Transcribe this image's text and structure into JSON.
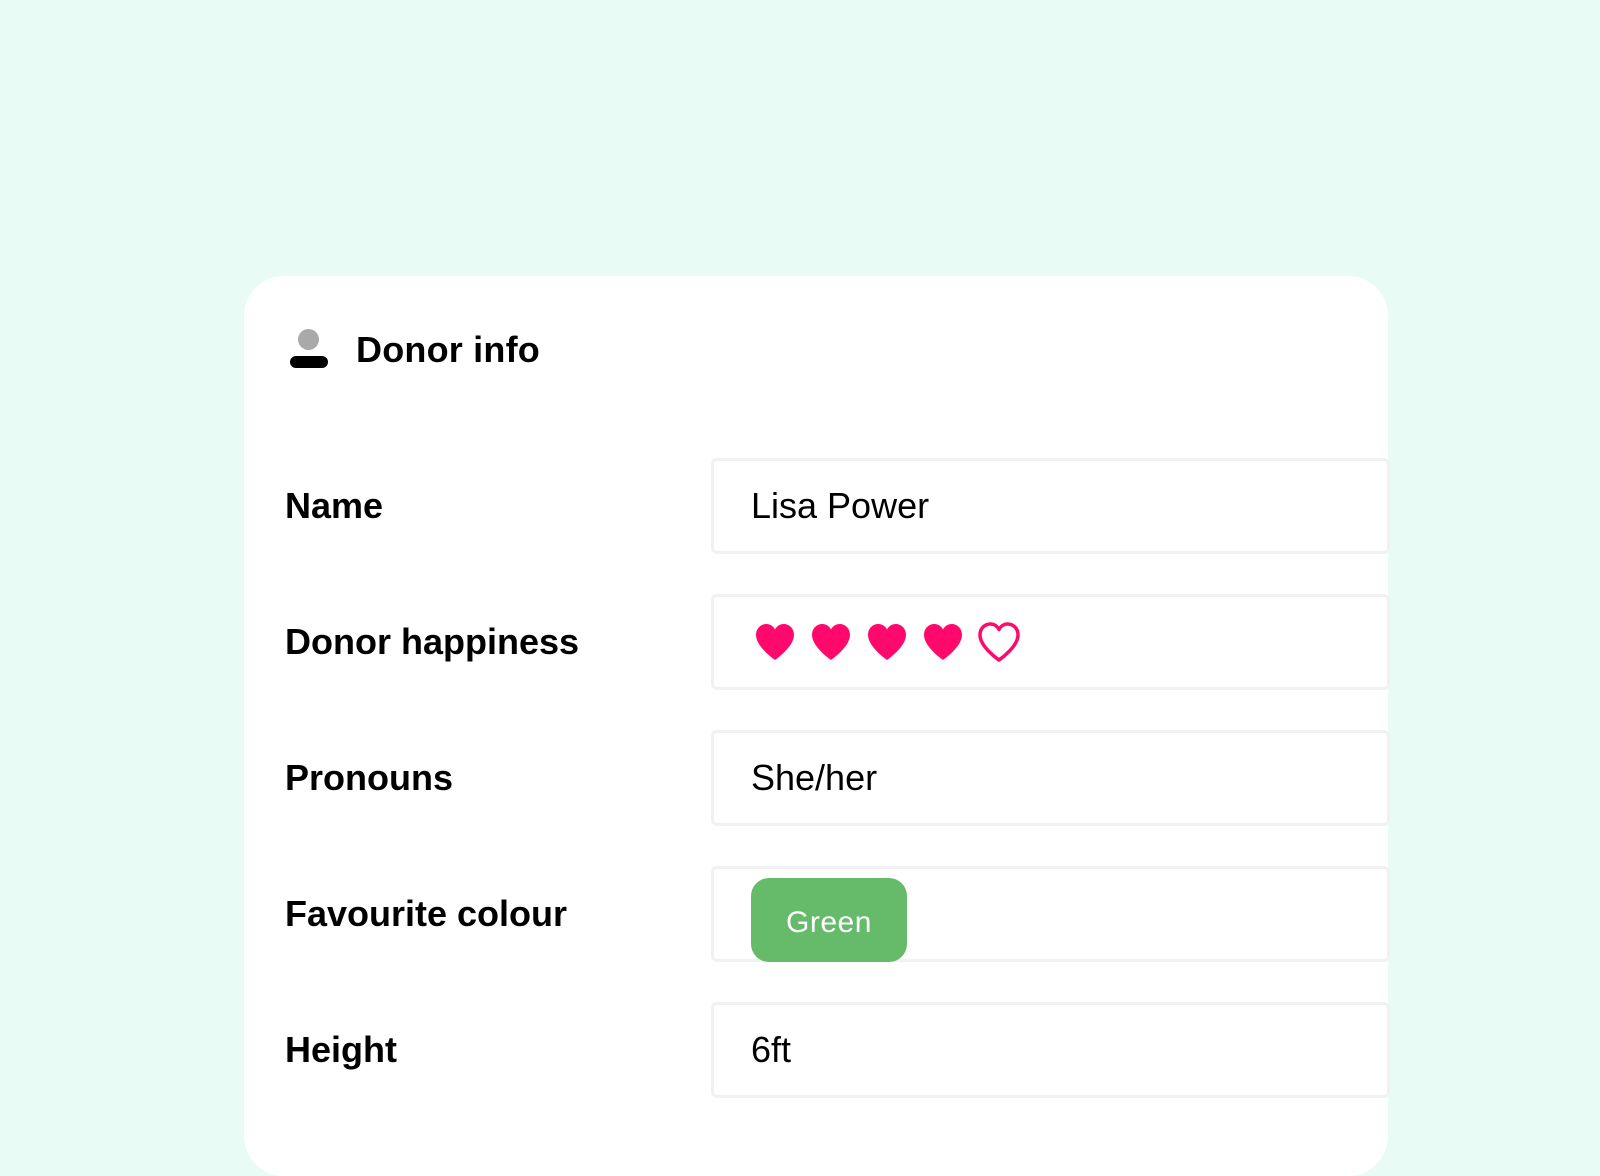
{
  "card": {
    "title": "Donor info",
    "icon": "person-icon"
  },
  "fields": {
    "name": {
      "label": "Name",
      "value": "Lisa Power"
    },
    "happiness": {
      "label": "Donor happiness",
      "rating": 4,
      "max": 5,
      "icon": "heart-icon",
      "color": "#ff0a6c"
    },
    "pronouns": {
      "label": "Pronouns",
      "value": "She/her"
    },
    "colour": {
      "label": "Favourite colour",
      "value": "Green",
      "tag_color": "#65bb6a"
    },
    "height": {
      "label": "Height",
      "value": "6ft"
    }
  },
  "colors": {
    "background": "#e8fcf5",
    "card": "#ffffff",
    "field_border": "#f1f1f1"
  }
}
